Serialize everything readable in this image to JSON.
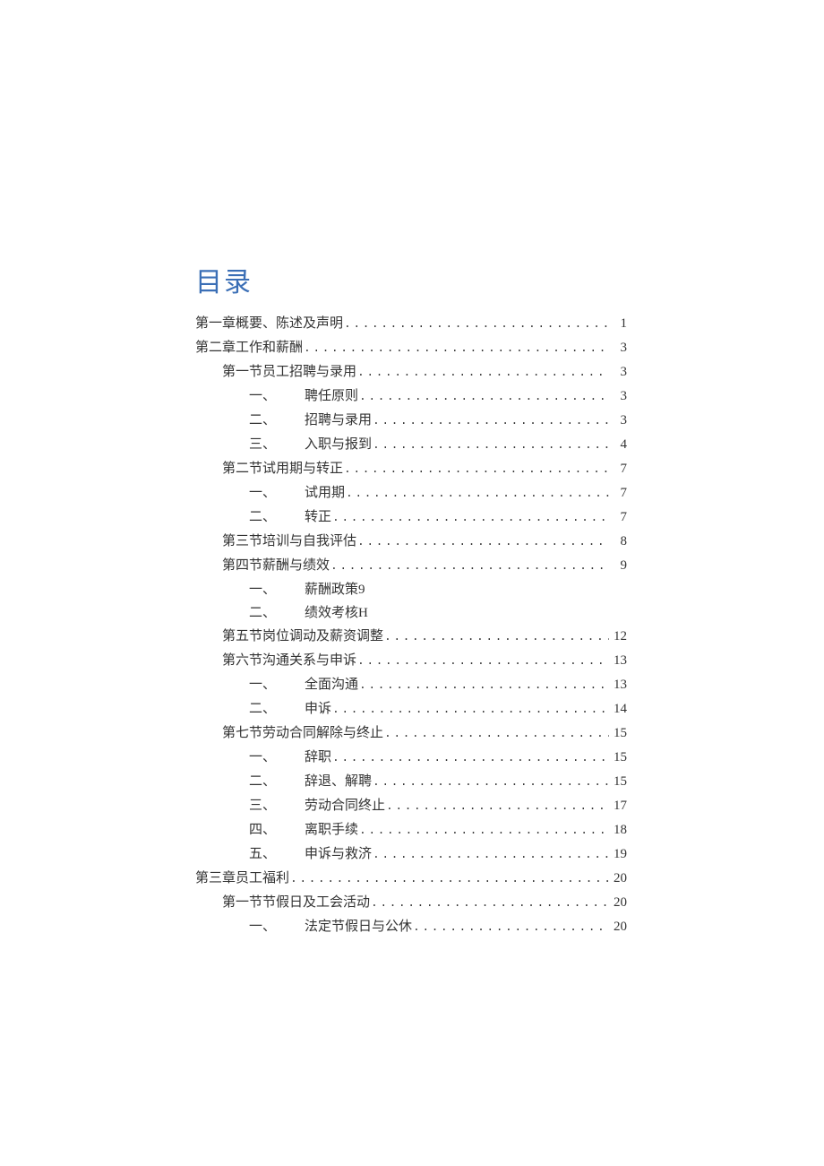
{
  "title": "目录",
  "entries": [
    {
      "indent": 0,
      "num": "",
      "label": "第一章概要、陈述及声明",
      "page": "1",
      "dots": true
    },
    {
      "indent": 0,
      "num": "",
      "label": "第二章工作和薪酬",
      "page": "3",
      "dots": true
    },
    {
      "indent": 1,
      "num": "",
      "label": "第一节员工招聘与录用",
      "page": "3",
      "dots": true
    },
    {
      "indent": 2,
      "num": "一、",
      "label": "聘任原则",
      "page": "3",
      "dots": true
    },
    {
      "indent": 2,
      "num": "二、",
      "label": "招聘与录用",
      "page": "3",
      "dots": true
    },
    {
      "indent": 2,
      "num": "三、",
      "label": "入职与报到",
      "page": "4",
      "dots": true
    },
    {
      "indent": 1,
      "num": "",
      "label": "第二节试用期与转正",
      "page": "7",
      "dots": true
    },
    {
      "indent": 2,
      "num": "一、",
      "label": "试用期",
      "page": "7",
      "dots": true
    },
    {
      "indent": 2,
      "num": "二、",
      "label": "转正",
      "page": "7",
      "dots": true
    },
    {
      "indent": 1,
      "num": "第三节",
      "label": "培训与自我评估",
      "page": "8",
      "dots": true
    },
    {
      "indent": 1,
      "num": "第四节",
      "label": "薪酬与绩效",
      "page": "9",
      "dots": true
    },
    {
      "indent": 2,
      "num": "一、",
      "label": "薪酬政策",
      "page": "9",
      "dots": false
    },
    {
      "indent": 2,
      "num": "二、",
      "label": "绩效考核",
      "page": "H",
      "dots": false
    },
    {
      "indent": 1,
      "num": "第五节",
      "label": "岗位调动及薪资调整",
      "page": "12",
      "dots": true
    },
    {
      "indent": 1,
      "num": "第六节",
      "label": "沟通关系与申诉",
      "page": "13",
      "dots": true
    },
    {
      "indent": 2,
      "num": "一、",
      "label": "全面沟通",
      "page": "13",
      "dots": true
    },
    {
      "indent": 2,
      "num": "二、",
      "label": "申诉",
      "page": "14",
      "dots": true
    },
    {
      "indent": 1,
      "num": "第七节",
      "label": "劳动合同解除与终止",
      "page": "15",
      "dots": true
    },
    {
      "indent": 2,
      "num": "一、",
      "label": "辞职",
      "page": "15",
      "dots": true
    },
    {
      "indent": 2,
      "num": "二、",
      "label": "辞退、解聘",
      "page": "15",
      "dots": true
    },
    {
      "indent": 2,
      "num": "三、",
      "label": "劳动合同终止",
      "page": "17",
      "dots": true
    },
    {
      "indent": 2,
      "num": "四、",
      "label": "离职手续",
      "page": "18",
      "dots": true
    },
    {
      "indent": 2,
      "num": "五、",
      "label": "申诉与救济",
      "page": "19",
      "dots": true
    },
    {
      "indent": 0,
      "num": "",
      "label": "第三章员工福利",
      "page": "20",
      "dots": true
    },
    {
      "indent": 1,
      "num": "第一节",
      "label": "节假日及工会活动",
      "page": "20",
      "dots": true
    },
    {
      "indent": 2,
      "num": "一、",
      "label": "法定节假日与公休",
      "page": "20",
      "dots": true
    }
  ]
}
